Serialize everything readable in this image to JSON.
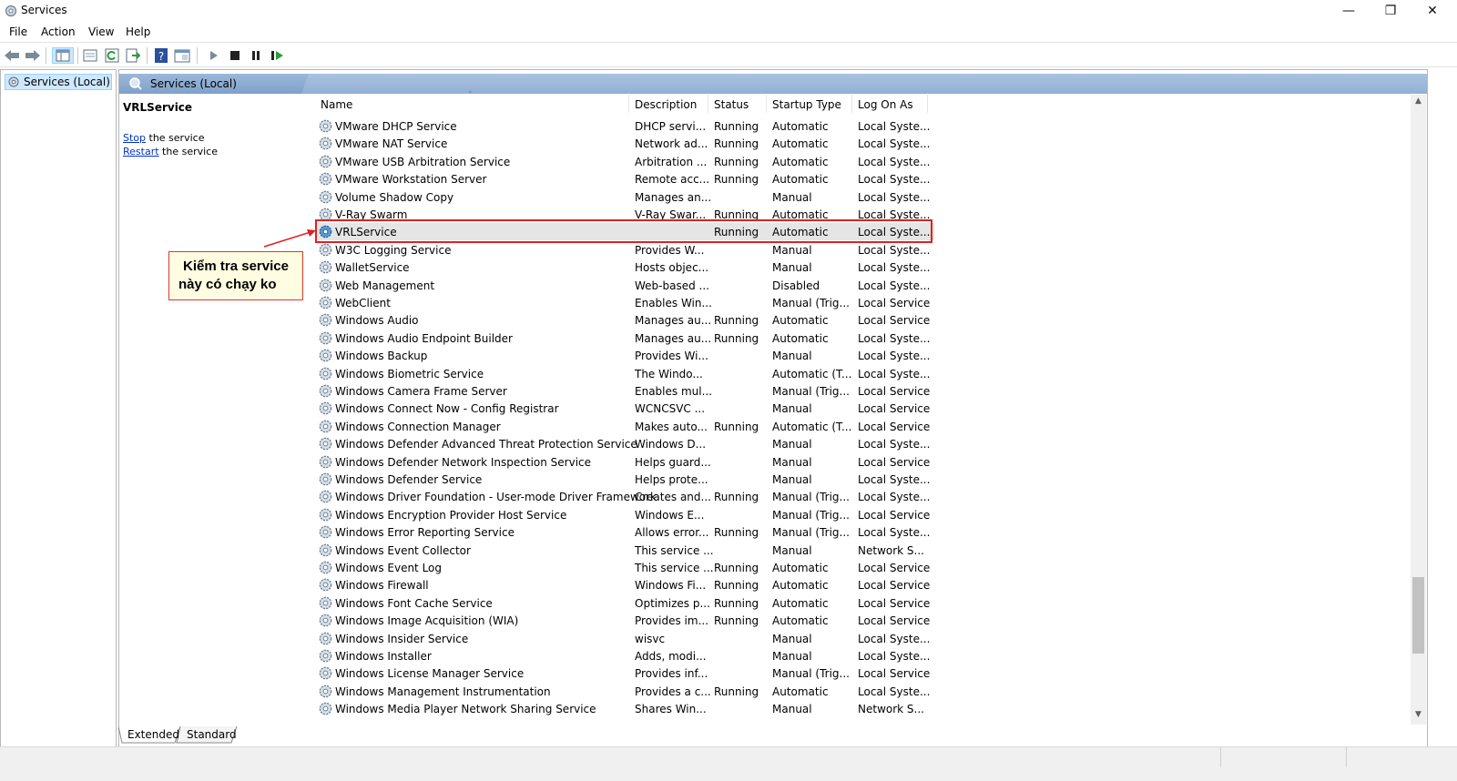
{
  "window": {
    "title": "Services",
    "controls": {
      "minimize": "—",
      "restore": "❐",
      "close": "✕"
    }
  },
  "menu": [
    "File",
    "Action",
    "View",
    "Help"
  ],
  "tree": {
    "root": "Services (Local)"
  },
  "pane": {
    "header": "Services (Local)",
    "selected_service": "VRLService",
    "actions": [
      {
        "link": "Stop",
        "text": " the service"
      },
      {
        "link": "Restart",
        "text": " the service"
      }
    ]
  },
  "annotation": {
    "line1": "Kiểm tra service",
    "line2": "này có chạy ko"
  },
  "columns": [
    "Name",
    "Description",
    "Status",
    "Startup Type",
    "Log On As"
  ],
  "rows": [
    {
      "name": "VMware DHCP Service",
      "description": "DHCP servi...",
      "status": "Running",
      "startup": "Automatic",
      "logon": "Local Syste..."
    },
    {
      "name": "VMware NAT Service",
      "description": "Network ad...",
      "status": "Running",
      "startup": "Automatic",
      "logon": "Local Syste..."
    },
    {
      "name": "VMware USB Arbitration Service",
      "description": "Arbitration ...",
      "status": "Running",
      "startup": "Automatic",
      "logon": "Local Syste..."
    },
    {
      "name": "VMware Workstation Server",
      "description": "Remote acc...",
      "status": "Running",
      "startup": "Automatic",
      "logon": "Local Syste..."
    },
    {
      "name": "Volume Shadow Copy",
      "description": "Manages an...",
      "status": "",
      "startup": "Manual",
      "logon": "Local Syste..."
    },
    {
      "name": "V-Ray Swarm",
      "description": "V-Ray Swar...",
      "status": "Running",
      "startup": "Automatic",
      "logon": "Local Syste..."
    },
    {
      "name": "VRLService",
      "description": "",
      "status": "Running",
      "startup": "Automatic",
      "logon": "Local Syste..."
    },
    {
      "name": "W3C Logging Service",
      "description": "Provides W...",
      "status": "",
      "startup": "Manual",
      "logon": "Local Syste..."
    },
    {
      "name": "WalletService",
      "description": "Hosts objec...",
      "status": "",
      "startup": "Manual",
      "logon": "Local Syste..."
    },
    {
      "name": "Web Management",
      "description": "Web-based ...",
      "status": "",
      "startup": "Disabled",
      "logon": "Local Syste..."
    },
    {
      "name": "WebClient",
      "description": "Enables Win...",
      "status": "",
      "startup": "Manual (Trig...",
      "logon": "Local Service"
    },
    {
      "name": "Windows Audio",
      "description": "Manages au...",
      "status": "Running",
      "startup": "Automatic",
      "logon": "Local Service"
    },
    {
      "name": "Windows Audio Endpoint Builder",
      "description": "Manages au...",
      "status": "Running",
      "startup": "Automatic",
      "logon": "Local Syste..."
    },
    {
      "name": "Windows Backup",
      "description": "Provides Wi...",
      "status": "",
      "startup": "Manual",
      "logon": "Local Syste..."
    },
    {
      "name": "Windows Biometric Service",
      "description": "The Windo...",
      "status": "",
      "startup": "Automatic (T...",
      "logon": "Local Syste..."
    },
    {
      "name": "Windows Camera Frame Server",
      "description": "Enables mul...",
      "status": "",
      "startup": "Manual (Trig...",
      "logon": "Local Service"
    },
    {
      "name": "Windows Connect Now - Config Registrar",
      "description": "WCNCSVC ...",
      "status": "",
      "startup": "Manual",
      "logon": "Local Service"
    },
    {
      "name": "Windows Connection Manager",
      "description": "Makes auto...",
      "status": "Running",
      "startup": "Automatic (T...",
      "logon": "Local Service"
    },
    {
      "name": "Windows Defender Advanced Threat Protection Service",
      "description": "Windows D...",
      "status": "",
      "startup": "Manual",
      "logon": "Local Syste..."
    },
    {
      "name": "Windows Defender Network Inspection Service",
      "description": "Helps guard...",
      "status": "",
      "startup": "Manual",
      "logon": "Local Service"
    },
    {
      "name": "Windows Defender Service",
      "description": "Helps prote...",
      "status": "",
      "startup": "Manual",
      "logon": "Local Syste..."
    },
    {
      "name": "Windows Driver Foundation - User-mode Driver Framework",
      "description": "Creates and...",
      "status": "Running",
      "startup": "Manual (Trig...",
      "logon": "Local Syste..."
    },
    {
      "name": "Windows Encryption Provider Host Service",
      "description": "Windows E...",
      "status": "",
      "startup": "Manual (Trig...",
      "logon": "Local Service"
    },
    {
      "name": "Windows Error Reporting Service",
      "description": "Allows error...",
      "status": "Running",
      "startup": "Manual (Trig...",
      "logon": "Local Syste..."
    },
    {
      "name": "Windows Event Collector",
      "description": "This service ...",
      "status": "",
      "startup": "Manual",
      "logon": "Network S..."
    },
    {
      "name": "Windows Event Log",
      "description": "This service ...",
      "status": "Running",
      "startup": "Automatic",
      "logon": "Local Service"
    },
    {
      "name": "Windows Firewall",
      "description": "Windows Fi...",
      "status": "Running",
      "startup": "Automatic",
      "logon": "Local Service"
    },
    {
      "name": "Windows Font Cache Service",
      "description": "Optimizes p...",
      "status": "Running",
      "startup": "Automatic",
      "logon": "Local Service"
    },
    {
      "name": "Windows Image Acquisition (WIA)",
      "description": "Provides im...",
      "status": "Running",
      "startup": "Automatic",
      "logon": "Local Service"
    },
    {
      "name": "Windows Insider Service",
      "description": "wisvc",
      "status": "",
      "startup": "Manual",
      "logon": "Local Syste..."
    },
    {
      "name": "Windows Installer",
      "description": "Adds, modi...",
      "status": "",
      "startup": "Manual",
      "logon": "Local Syste..."
    },
    {
      "name": "Windows License Manager Service",
      "description": "Provides inf...",
      "status": "",
      "startup": "Manual (Trig...",
      "logon": "Local Service"
    },
    {
      "name": "Windows Management Instrumentation",
      "description": "Provides a c...",
      "status": "Running",
      "startup": "Automatic",
      "logon": "Local Syste..."
    },
    {
      "name": "Windows Media Player Network Sharing Service",
      "description": "Shares Win...",
      "status": "",
      "startup": "Manual",
      "logon": "Network S..."
    }
  ],
  "selected_row": 6,
  "bottom_tabs": [
    "Extended",
    "Standard"
  ],
  "colors": {
    "highlight": "#e02020",
    "link": "#0033cc",
    "header": "#92b0d4",
    "note_bg": "#fffde1"
  }
}
